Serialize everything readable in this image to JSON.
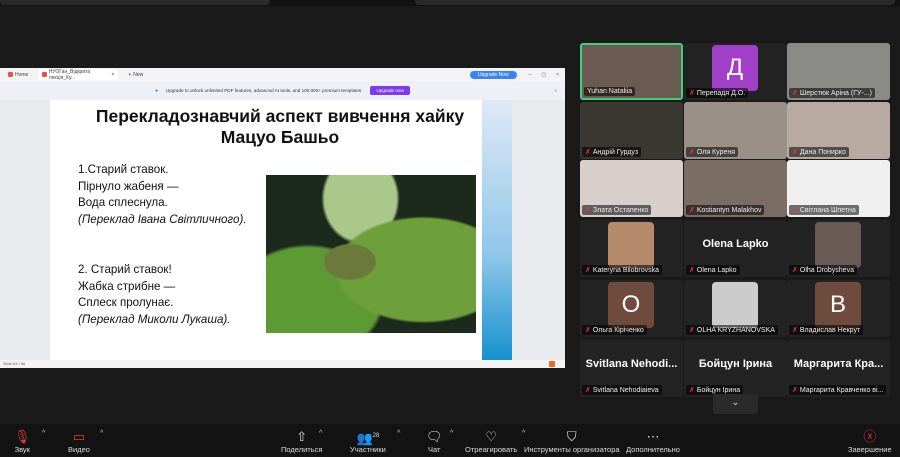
{
  "viewer": {
    "tabs": [
      {
        "label": "Home"
      },
      {
        "label": "НУОГан_Відкрита лекція_Ку..."
      },
      {
        "label": "New"
      }
    ],
    "upgrade_now": "Upgrade Now",
    "banner_text": "Upgrade to unlock unlimited PDF features, advanced AI tools, and 100,000+ premium templates.",
    "banner_button": "Upgrade now",
    "status": "Slide 63 / 86"
  },
  "slide": {
    "title_line1": "Перекладознавчий аспект вивчення хайку",
    "title_line2": "Мацуо Башьо",
    "poem1": [
      "1.Старий ставок.",
      "Пірнуло жабеня —",
      "Вода сплеснула.",
      "(Переклад Івана Світличного)."
    ],
    "poem2": [
      "2. Старий ставок!",
      "Жабка стрибне —",
      "Сплеск пролунає.",
      "(Переклад Миколи Лукаша)."
    ]
  },
  "participants": [
    {
      "name": "Yuhan Nataliia",
      "muted": false
    },
    {
      "name": "Перепадя Д.О.",
      "avatar": "Д",
      "color": "#a13fc8"
    },
    {
      "name": "Шерстюк Аріна (ГУ-...)"
    },
    {
      "name": "Андрій Гурдуз"
    },
    {
      "name": "Оля Куреня"
    },
    {
      "name": "Дана Понирко"
    },
    {
      "name": "Злата Остапенко"
    },
    {
      "name": "Kostiantyn Malakhov"
    },
    {
      "name": "Світлана Шпетна"
    },
    {
      "name": "Kateryna Bilobrovska"
    },
    {
      "name": "Olena Lapko",
      "big": "Olena Lapko"
    },
    {
      "name": "Olha Drobysheva"
    },
    {
      "name": "Ольга Кіріченко",
      "avatar": "O",
      "color": "#6e4b3d"
    },
    {
      "name": "OLHA KRYZHANOVSKA"
    },
    {
      "name": "Владислав Некрут",
      "avatar": "B",
      "color": "#6e4b3d"
    },
    {
      "name": "Svitlana Nehodiaieva",
      "big": "Svitlana  Nehodi..."
    },
    {
      "name": "Бойцун Ірина",
      "big": "Бойцун Ірина"
    },
    {
      "name": "Маргарита Кравченко ві...",
      "big": "Маргарита  Кра..."
    }
  ],
  "toolbar": {
    "audio": "Звук",
    "video": "Видео",
    "share": "Поделиться",
    "participants": "Участники",
    "participants_count": "28",
    "chat": "Чат",
    "react": "Отреагировать",
    "host_tools": "Инструменты организатора",
    "more": "Дополнительно",
    "end": "Завершение"
  }
}
